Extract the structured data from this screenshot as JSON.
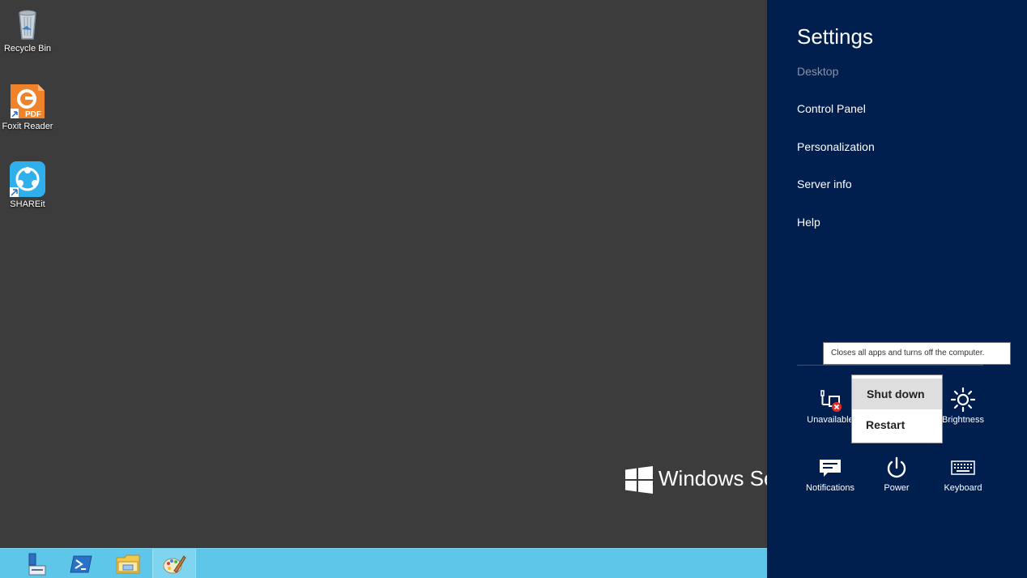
{
  "desktop": {
    "icons": [
      {
        "label": "Recycle Bin",
        "icon": "recycle-bin-icon"
      },
      {
        "label": "Foxit Reader",
        "icon": "foxit-reader-icon"
      },
      {
        "label": "SHAREit",
        "icon": "shareit-icon"
      }
    ],
    "watermark": "Windows Ser"
  },
  "taskbar": {
    "items": [
      {
        "icon": "server-manager-icon"
      },
      {
        "icon": "powershell-icon"
      },
      {
        "icon": "file-explorer-icon"
      },
      {
        "icon": "paint-icon"
      }
    ]
  },
  "settings": {
    "title": "Settings",
    "context": "Desktop",
    "links": [
      "Control Panel",
      "Personalization",
      "Server info",
      "Help"
    ],
    "tiles": [
      {
        "label": "Unavailable",
        "icon": "network-unavailable-icon"
      },
      {
        "label": "Brightness",
        "icon": "brightness-icon"
      },
      {
        "label": "Notifications",
        "icon": "notifications-icon"
      },
      {
        "label": "Power",
        "icon": "power-icon"
      },
      {
        "label": "Keyboard",
        "icon": "keyboard-icon"
      }
    ]
  },
  "tooltip": "Closes all apps and turns off the computer.",
  "power_menu": {
    "items": [
      "Shut down",
      "Restart"
    ]
  },
  "colors": {
    "charm_bg": "#001e4e",
    "taskbar_bg": "#5ec6e8",
    "desktop_bg": "#3c3c3c"
  }
}
